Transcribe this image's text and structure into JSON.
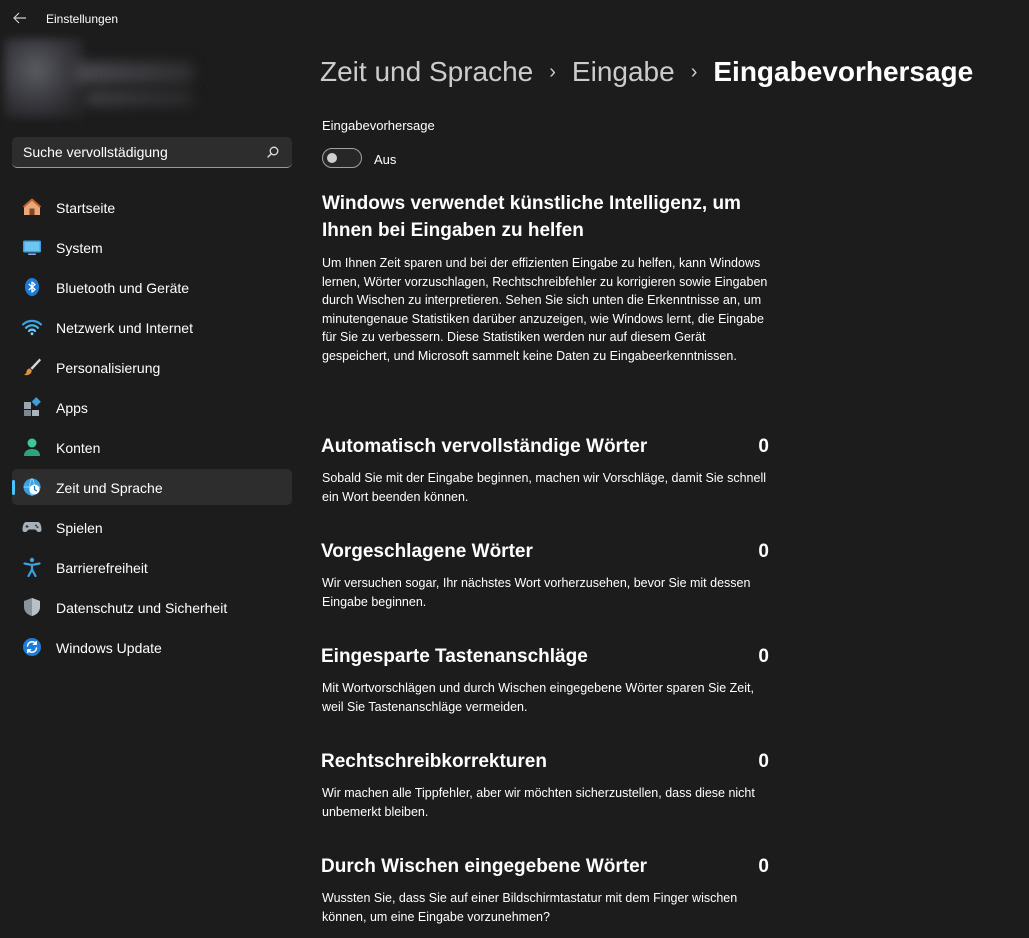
{
  "app": {
    "title": "Einstellungen"
  },
  "search": {
    "value": "Suche vervollstädigung"
  },
  "nav": {
    "items": [
      {
        "label": "Startseite",
        "icon": "home-icon"
      },
      {
        "label": "System",
        "icon": "monitor-icon"
      },
      {
        "label": "Bluetooth und Geräte",
        "icon": "bluetooth-icon"
      },
      {
        "label": "Netzwerk und Internet",
        "icon": "wifi-icon"
      },
      {
        "label": "Personalisierung",
        "icon": "brush-icon"
      },
      {
        "label": "Apps",
        "icon": "apps-icon"
      },
      {
        "label": "Konten",
        "icon": "person-icon"
      },
      {
        "label": "Zeit und Sprache",
        "icon": "globe-clock-icon",
        "selected": true
      },
      {
        "label": "Spielen",
        "icon": "gamepad-icon"
      },
      {
        "label": "Barrierefreiheit",
        "icon": "accessibility-icon"
      },
      {
        "label": "Datenschutz und Sicherheit",
        "icon": "shield-icon"
      },
      {
        "label": "Windows Update",
        "icon": "update-icon"
      }
    ]
  },
  "breadcrumb": {
    "part1": "Zeit und Sprache",
    "part2": "Eingabe",
    "current": "Eingabevorhersage"
  },
  "prediction": {
    "label": "Eingabevorhersage",
    "toggle_on": false,
    "toggle_state": "Aus"
  },
  "ai": {
    "heading": "Windows verwendet künstliche Intelligenz, um Ihnen bei Eingaben zu helfen",
    "description": "Um Ihnen Zeit sparen und bei der effizienten Eingabe zu helfen, kann Windows lernen, Wörter vorzuschlagen, Rechtschreibfehler zu korrigieren sowie Eingaben durch Wischen zu interpretieren. Sehen Sie sich unten die Erkenntnisse an, um minutengenaue Statistiken darüber anzuzeigen, wie Windows lernt, die Eingabe für Sie zu verbessern. Diese Statistiken werden nur auf diesem Gerät gespeichert, und Microsoft sammelt keine Daten zu Eingabeerkenntnissen."
  },
  "stats": [
    {
      "title": "Automatisch vervollständige Wörter",
      "value": "0",
      "description": "Sobald Sie mit der Eingabe beginnen, machen wir Vorschläge, damit Sie schnell ein Wort beenden können."
    },
    {
      "title": "Vorgeschlagene Wörter",
      "value": "0",
      "description": "Wir versuchen sogar, Ihr nächstes Wort vorherzusehen, bevor Sie mit dessen Eingabe beginnen."
    },
    {
      "title": "Eingesparte Tastenanschläge",
      "value": "0",
      "description": "Mit Wortvorschlägen und durch Wischen eingegebene Wörter sparen Sie Zeit, weil Sie Tastenanschläge vermeiden."
    },
    {
      "title": "Rechtschreibkorrekturen",
      "value": "0",
      "description": "Wir machen alle Tippfehler, aber wir möchten sicherzustellen, dass diese nicht unbemerkt bleiben."
    },
    {
      "title": "Durch Wischen eingegebene Wörter",
      "value": "0",
      "description": "Wussten Sie, dass Sie auf einer Bildschirmtastatur mit dem Finger wischen können, um eine Eingabe vorzunehmen?"
    }
  ],
  "colors": {
    "accent": "#4cc2ff",
    "background": "#1c1c1c",
    "selected_item": "#2d2d2d"
  }
}
